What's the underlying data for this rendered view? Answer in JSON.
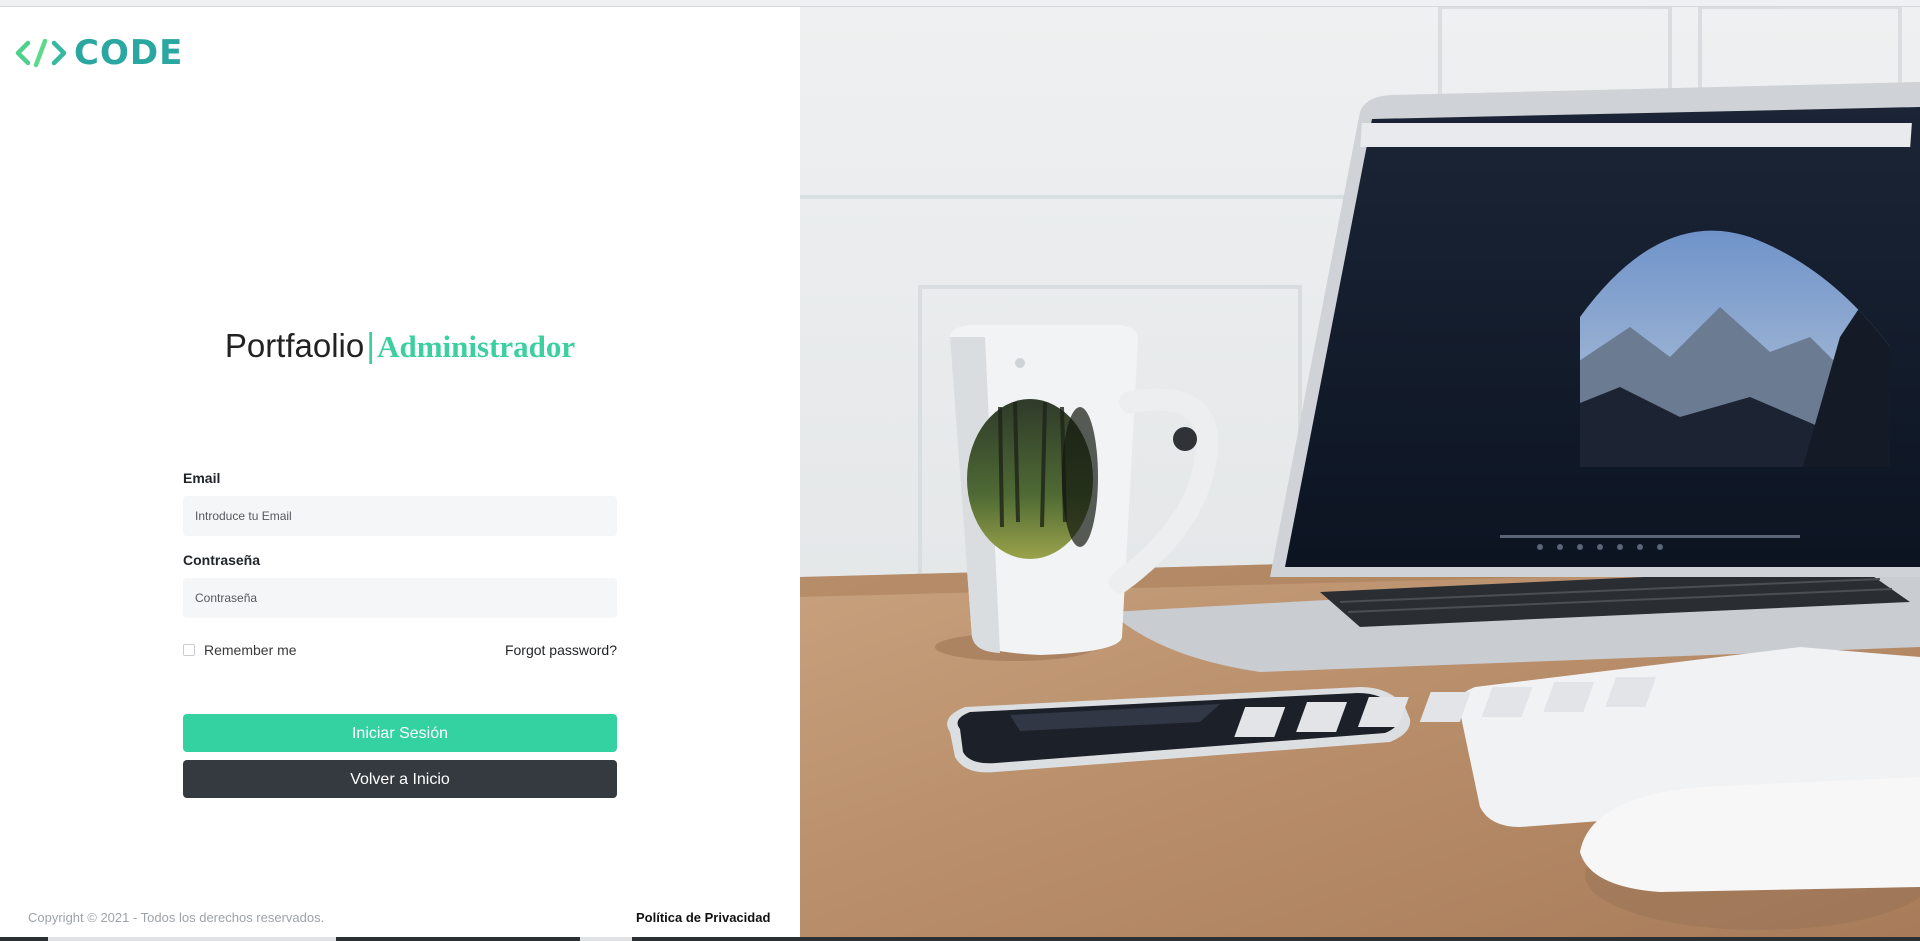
{
  "logo": {
    "text": "CODE"
  },
  "heading": {
    "main": "Portfaolio",
    "separator": "|",
    "accent": "Administrador"
  },
  "form": {
    "email_label": "Email",
    "email_placeholder": "Introduce tu Email",
    "email_value": "",
    "password_label": "Contraseña",
    "password_placeholder": "Contraseña",
    "password_value": "",
    "remember_label": "Remember me",
    "remember_checked": false,
    "forgot_label": "Forgot password?",
    "login_button": "Iniciar Sesión",
    "back_button": "Volver a Inicio"
  },
  "footer": {
    "copyright": "Copyright © 2021 - Todos los derechos reservados.",
    "privacy_link": "Política de Privacidad"
  },
  "colors": {
    "accent": "#34d1a1",
    "logo": "#2aa7a0",
    "dark_button": "#343a40",
    "input_bg": "#f5f6f8"
  },
  "hero_image": {
    "icons": [
      "mug-icon",
      "laptop-icon",
      "phone-icon",
      "keyboard-icon",
      "mouse-icon"
    ]
  }
}
